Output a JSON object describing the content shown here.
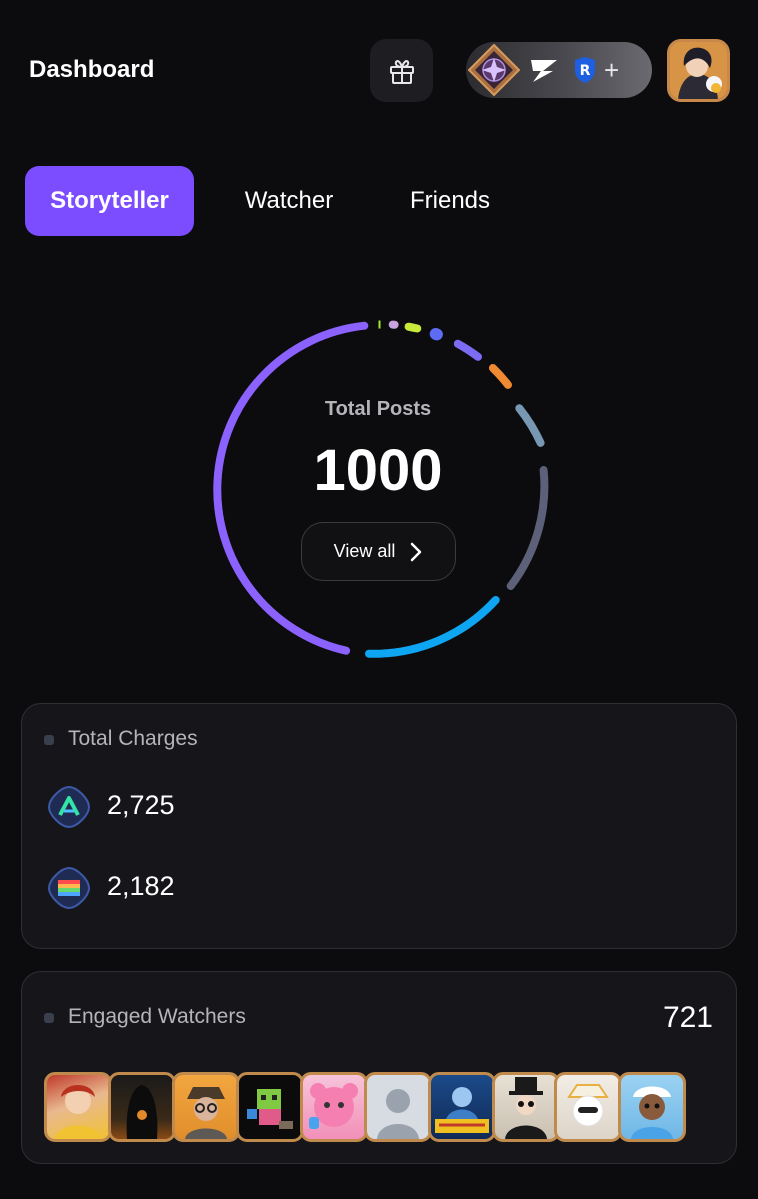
{
  "header": {
    "title": "Dashboard",
    "gift_icon": "gift-icon",
    "chain_icons": [
      "chain-badge-icon",
      "z-logo-icon",
      "r-shield-icon",
      "plus-icon"
    ],
    "plus": "+"
  },
  "tabs": [
    {
      "label": "Storyteller",
      "active": true
    },
    {
      "label": "Watcher",
      "active": false
    },
    {
      "label": "Friends",
      "active": false
    }
  ],
  "posts": {
    "label": "Total Posts",
    "value": "1000",
    "view_all": "View all"
  },
  "colors": {
    "accent": "#7c4dff",
    "background": "#0c0c0f",
    "card": "#16161a",
    "ring_segments": [
      "#8c62ff",
      "#0ea5f2",
      "#5c6079",
      "#7897b3",
      "#ef8a33",
      "#7c6cf3",
      "#5e6bf4",
      "#c8ea3a",
      "#c9a3e0",
      "#a3e635"
    ]
  },
  "charges": {
    "title": "Total Charges",
    "items": [
      {
        "icon": "a-token-icon",
        "value": "2,725"
      },
      {
        "icon": "rainbow-token-icon",
        "value": "2,182"
      }
    ]
  },
  "watchers": {
    "title": "Engaged Watchers",
    "count": "721",
    "avatars": [
      "red-hair-hero-avatar",
      "hooded-figure-avatar",
      "glasses-hat-avatar",
      "pixel-creature-avatar",
      "pink-bear-avatar",
      "default-user-avatar",
      "thunder-warrior-avatar",
      "top-hat-avatar",
      "white-cat-avatar",
      "blue-cap-avatar"
    ]
  }
}
